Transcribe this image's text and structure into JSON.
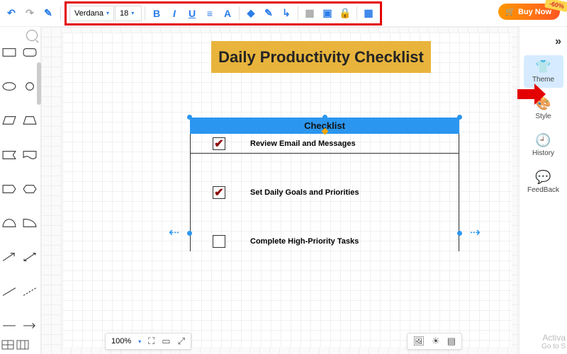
{
  "toolbar": {
    "font_family": "Verdana",
    "font_size": "18",
    "bold": "B",
    "italic": "I",
    "underline": "U",
    "align": "≡",
    "text_color": "A",
    "fill": "◆",
    "stroke": "✎",
    "connector": "↳",
    "layer1": "▦",
    "layer2": "▣",
    "lock": "🔒",
    "grid": "▦"
  },
  "buy": {
    "label": "Buy Now",
    "discount": "-60%"
  },
  "canvas": {
    "title": "Daily Productivity Checklist",
    "table": {
      "header": "Checklist",
      "rows": [
        {
          "checked": true,
          "text": "Review Email and Messages"
        },
        {
          "checked": true,
          "text": "Set Daily Goals and Priorities"
        },
        {
          "checked": false,
          "text": "Complete High-Priority Tasks"
        }
      ]
    }
  },
  "right_panel": {
    "items": [
      {
        "label": "Theme"
      },
      {
        "label": "Style"
      },
      {
        "label": "History"
      },
      {
        "label": "FeedBack"
      }
    ]
  },
  "zoom": {
    "level": "100%"
  },
  "watermark": {
    "line1": "Activa",
    "line2": "Go to S"
  }
}
